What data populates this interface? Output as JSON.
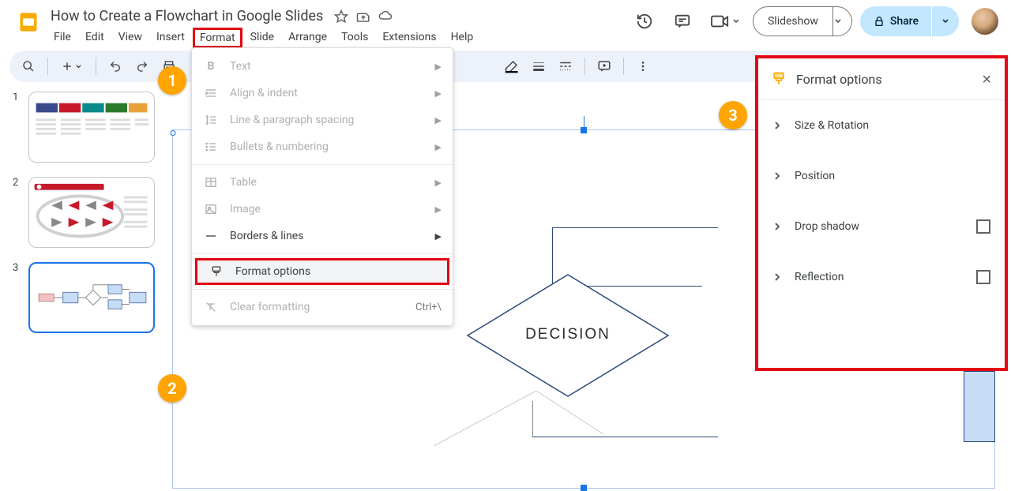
{
  "doc_title": "How to Create a Flowchart in Google Slides",
  "menu": {
    "file": "File",
    "edit": "Edit",
    "view": "View",
    "insert": "Insert",
    "format": "Format",
    "slide": "Slide",
    "arrange": "Arrange",
    "tools": "Tools",
    "extensions": "Extensions",
    "help": "Help"
  },
  "header": {
    "slideshow": "Slideshow",
    "share": "Share"
  },
  "dropdown": {
    "text": "Text",
    "align": "Align & indent",
    "line": "Line & paragraph spacing",
    "bullets": "Bullets & numbering",
    "table": "Table",
    "image": "Image",
    "borders": "Borders & lines",
    "options": "Format options",
    "clear": "Clear formatting",
    "clear_short": "Ctrl+\\"
  },
  "panel": {
    "title": "Format options",
    "size": "Size & Rotation",
    "position": "Position",
    "shadow": "Drop shadow",
    "reflection": "Reflection"
  },
  "canvas": {
    "decision": "DECISION"
  },
  "thumbs": {
    "n1": "1",
    "n2": "2",
    "n3": "3"
  },
  "badges": {
    "b1": "1",
    "b2": "2",
    "b3": "3"
  }
}
